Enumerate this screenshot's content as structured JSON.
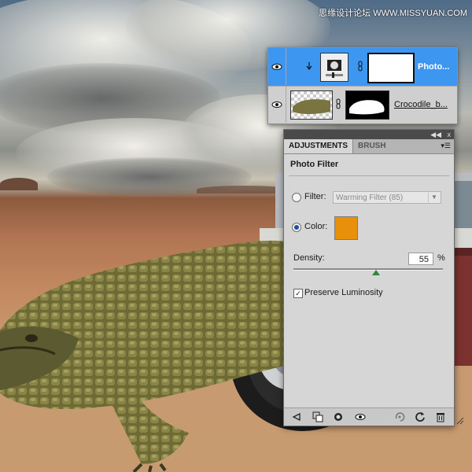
{
  "watermark": "思缘设计论坛 WWW.MISSYUAN.COM",
  "layers": {
    "items": [
      {
        "name": "Photo...",
        "selected": true,
        "icon": "adjustment-layer-icon"
      },
      {
        "name": "Crocodile_b...",
        "selected": false,
        "icon": "crocodile-thumbnail"
      }
    ]
  },
  "adjustments": {
    "tabs": [
      {
        "label": "ADJUSTMENTS",
        "active": true
      },
      {
        "label": "BRUSH",
        "active": false
      }
    ],
    "collapse_glyph": "◀◀",
    "close_glyph": "x",
    "title": "Photo Filter",
    "filter": {
      "label": "Filter:",
      "value": "Warming Filter (85)",
      "selected": false
    },
    "color": {
      "label": "Color:",
      "hex": "#e8900c",
      "selected": true
    },
    "density": {
      "label": "Density:",
      "value": "55",
      "unit": "%",
      "fraction": 0.55
    },
    "preserve_luminosity": {
      "label": "Preserve Luminosity",
      "checked": true
    },
    "footer_icons": [
      "back-arrow-icon",
      "clip-layer-icon",
      "mask-visibility-icon",
      "eye-icon",
      "previous-state-icon",
      "reset-icon",
      "trash-icon"
    ]
  },
  "colors": {
    "selection": "#3d96f0",
    "swatch": "#e8900c",
    "slider_thumb": "#2c8a3a"
  }
}
